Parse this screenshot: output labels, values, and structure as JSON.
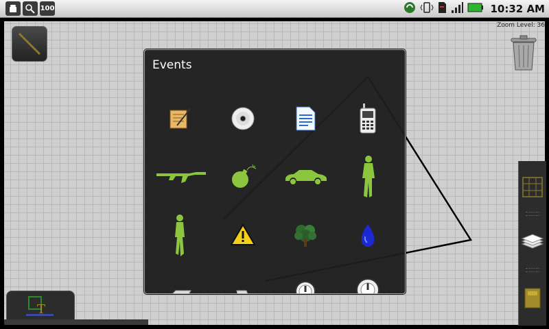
{
  "status_bar": {
    "battery_badge": "100",
    "time": "10:32 AM",
    "icons": [
      "android-debug-icon",
      "usb-icon",
      "battery-level-icon",
      "sync-icon",
      "vibrate-icon",
      "sd-card-icon",
      "signal-icon",
      "battery-icon"
    ]
  },
  "canvas": {
    "zoom_label": "Zoom Level: 36"
  },
  "dialog": {
    "title": "Events",
    "items": [
      {
        "icon": "notepad-icon"
      },
      {
        "icon": "cd-disc-icon"
      },
      {
        "icon": "document-icon"
      },
      {
        "icon": "cell-phone-icon"
      },
      {
        "icon": "rifle-icon"
      },
      {
        "icon": "bomb-icon"
      },
      {
        "icon": "car-icon"
      },
      {
        "icon": "person-standing-icon"
      },
      {
        "icon": "person-walking-icon"
      },
      {
        "icon": "warning-icon"
      },
      {
        "icon": "tree-icon"
      },
      {
        "icon": "water-drop-icon"
      },
      {
        "icon": "pipe-icon"
      },
      {
        "icon": "pipe-end-icon"
      },
      {
        "icon": "gauge-icon"
      },
      {
        "icon": "dial-icon"
      }
    ]
  },
  "toolbar": {
    "right_buttons": [
      "grid-icon",
      "layers-icon",
      "folder-icon"
    ]
  },
  "colors": {
    "accent_green": "#8cc63f",
    "dialog_bg": "#1e1e1e"
  }
}
